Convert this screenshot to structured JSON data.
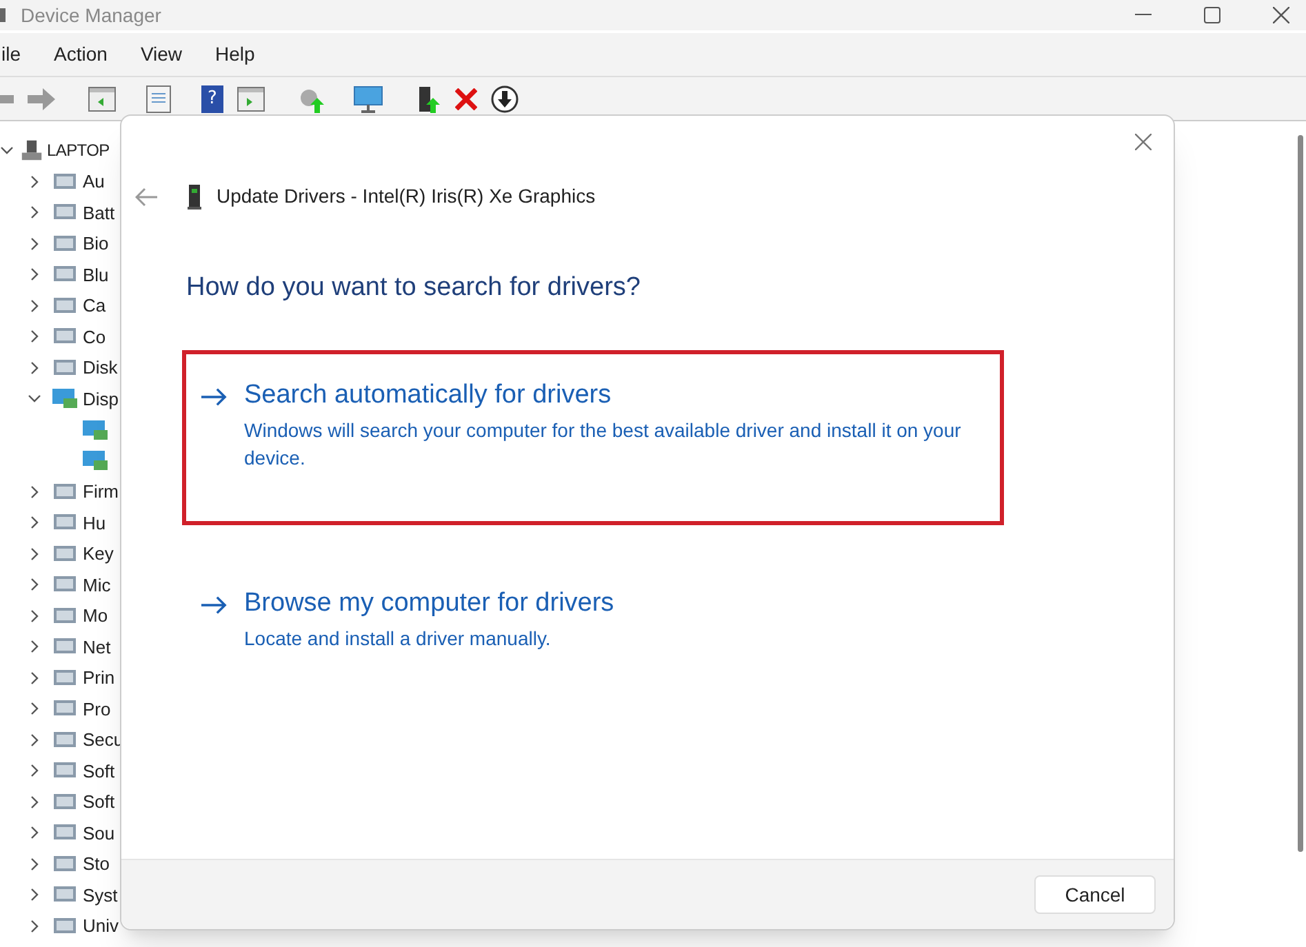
{
  "window": {
    "title": "Device Manager"
  },
  "menu": [
    "ile",
    "Action",
    "View",
    "Help"
  ],
  "toolbar": {
    "help_label": "?"
  },
  "tree": {
    "label": "LAPTOP",
    "expanded": true,
    "children": [
      {
        "label": "Au",
        "expanded": false
      },
      {
        "label": "Batt",
        "expanded": false
      },
      {
        "label": "Bio",
        "expanded": false
      },
      {
        "label": "Blu",
        "expanded": false
      },
      {
        "label": "Ca",
        "expanded": false
      },
      {
        "label": "Co",
        "expanded": false
      },
      {
        "label": "Disk",
        "expanded": false
      },
      {
        "label": "Disp",
        "expanded": true,
        "children": [
          {
            "kind": "display-adapter"
          },
          {
            "kind": "display-adapter"
          }
        ]
      },
      {
        "label": "Firm",
        "expanded": false
      },
      {
        "label": "Hu",
        "expanded": false
      },
      {
        "label": "Key",
        "expanded": false
      },
      {
        "label": "Mic",
        "expanded": false
      },
      {
        "label": "Mo",
        "expanded": false
      },
      {
        "label": "Net",
        "expanded": false
      },
      {
        "label": "Prin",
        "expanded": false
      },
      {
        "label": "Pro",
        "expanded": false
      },
      {
        "label": "Secu",
        "expanded": false
      },
      {
        "label": "Soft",
        "expanded": false
      },
      {
        "label": "Soft",
        "expanded": false
      },
      {
        "label": "Sou",
        "expanded": false
      },
      {
        "label": "Sto",
        "expanded": false
      },
      {
        "label": "Syst",
        "expanded": false
      },
      {
        "label": "Univ",
        "expanded": false
      }
    ]
  },
  "dialog": {
    "title": "Update Drivers - Intel(R) Iris(R) Xe Graphics",
    "heading": "How do you want to search for drivers?",
    "options": [
      {
        "title": "Search automatically for drivers",
        "description": "Windows will search your computer for the best available driver and install it on your device.",
        "highlighted": true
      },
      {
        "title": "Browse my computer for drivers",
        "description": "Locate and install a driver manually.",
        "highlighted": false
      }
    ],
    "buttons": [
      "Cancel"
    ]
  }
}
